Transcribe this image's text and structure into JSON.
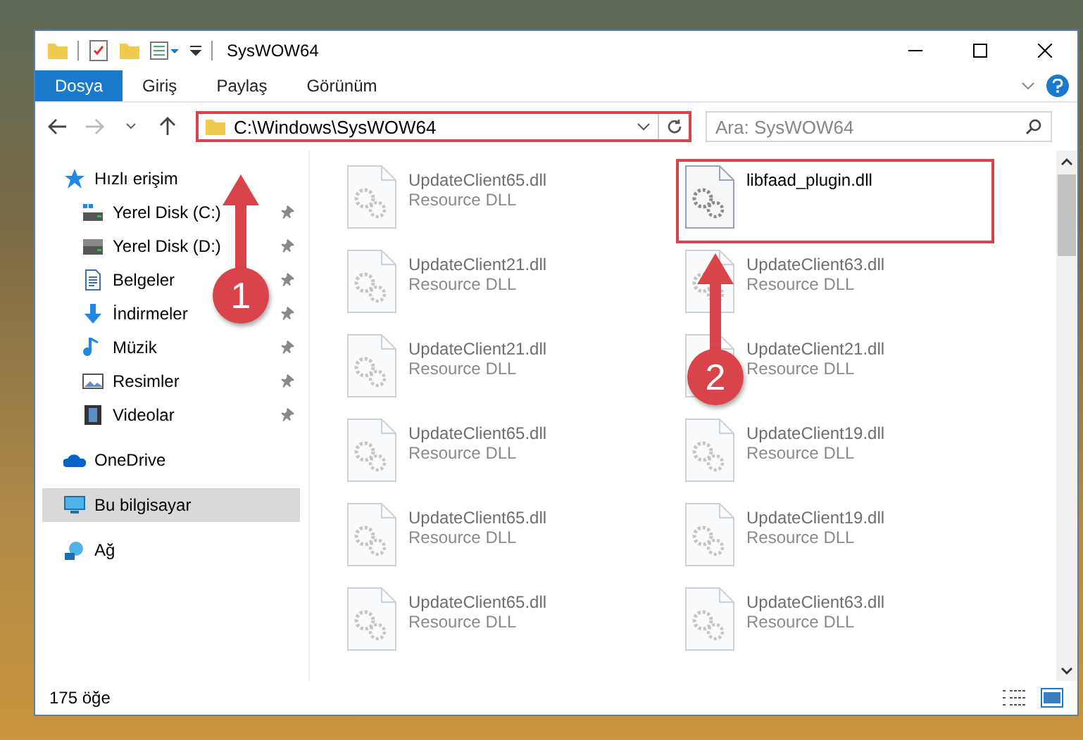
{
  "window": {
    "title": "SysWOW64"
  },
  "ribbon_tabs": [
    {
      "label": "Dosya",
      "selected": true
    },
    {
      "label": "Giriş",
      "selected": false
    },
    {
      "label": "Paylaş",
      "selected": false
    },
    {
      "label": "Görünüm",
      "selected": false
    }
  ],
  "address": {
    "path": "C:\\Windows\\SysWOW64",
    "highlighted": true
  },
  "search": {
    "placeholder": "Ara: SysWOW64"
  },
  "sidebar": {
    "items": [
      {
        "label": "Hızlı erişim",
        "kind": "star",
        "selected": false,
        "children": [
          {
            "label": "Yerel Disk (C:)",
            "kind": "system-drive",
            "pinned": true,
            "selected": false
          },
          {
            "label": "Yerel Disk (D:)",
            "kind": "drive",
            "pinned": true,
            "selected": false
          },
          {
            "label": "Belgeler",
            "kind": "document",
            "pinned": true,
            "selected": false
          },
          {
            "label": "İndirmeler",
            "kind": "download",
            "pinned": true,
            "selected": false
          },
          {
            "label": "Müzik",
            "kind": "music",
            "pinned": true,
            "selected": false
          },
          {
            "label": "Resimler",
            "kind": "picture",
            "pinned": true,
            "selected": false
          },
          {
            "label": "Videolar",
            "kind": "video",
            "pinned": true,
            "selected": false
          }
        ]
      },
      {
        "label": "OneDrive",
        "kind": "cloud",
        "selected": false
      },
      {
        "label": "Bu bilgisayar",
        "kind": "computer",
        "selected": true
      },
      {
        "label": "Ağ",
        "kind": "network",
        "selected": false
      }
    ]
  },
  "files": [
    {
      "name": "UpdateClient65.dll",
      "type": "Resource DLL",
      "blurred": true,
      "highlighted": false
    },
    {
      "name": "libfaad_plugin.dll",
      "blurred": false,
      "highlighted": true
    },
    {
      "name": "UpdateClient21.dll",
      "type": "Resource DLL",
      "blurred": true,
      "highlighted": false
    },
    {
      "name": "UpdateClient63.dll",
      "type": "Resource DLL",
      "blurred": true,
      "highlighted": false
    },
    {
      "name": "UpdateClient21.dll",
      "type": "Resource DLL",
      "blurred": true,
      "highlighted": false
    },
    {
      "name": "UpdateClient21.dll",
      "type": "Resource DLL",
      "blurred": true,
      "highlighted": false
    },
    {
      "name": "UpdateClient65.dll",
      "type": "Resource DLL",
      "blurred": true,
      "highlighted": false
    },
    {
      "name": "UpdateClient19.dll",
      "type": "Resource DLL",
      "blurred": true,
      "highlighted": false
    },
    {
      "name": "UpdateClient65.dll",
      "type": "Resource DLL",
      "blurred": true,
      "highlighted": false
    },
    {
      "name": "UpdateClient19.dll",
      "type": "Resource DLL",
      "blurred": true,
      "highlighted": false
    },
    {
      "name": "UpdateClient65.dll",
      "type": "Resource DLL",
      "blurred": true,
      "highlighted": false
    },
    {
      "name": "UpdateClient63.dll",
      "type": "Resource DLL",
      "blurred": true,
      "highlighted": false
    }
  ],
  "status_bar": {
    "item_count": "175 öğe"
  },
  "annotations": [
    {
      "label": "1"
    },
    {
      "label": "2"
    }
  ]
}
